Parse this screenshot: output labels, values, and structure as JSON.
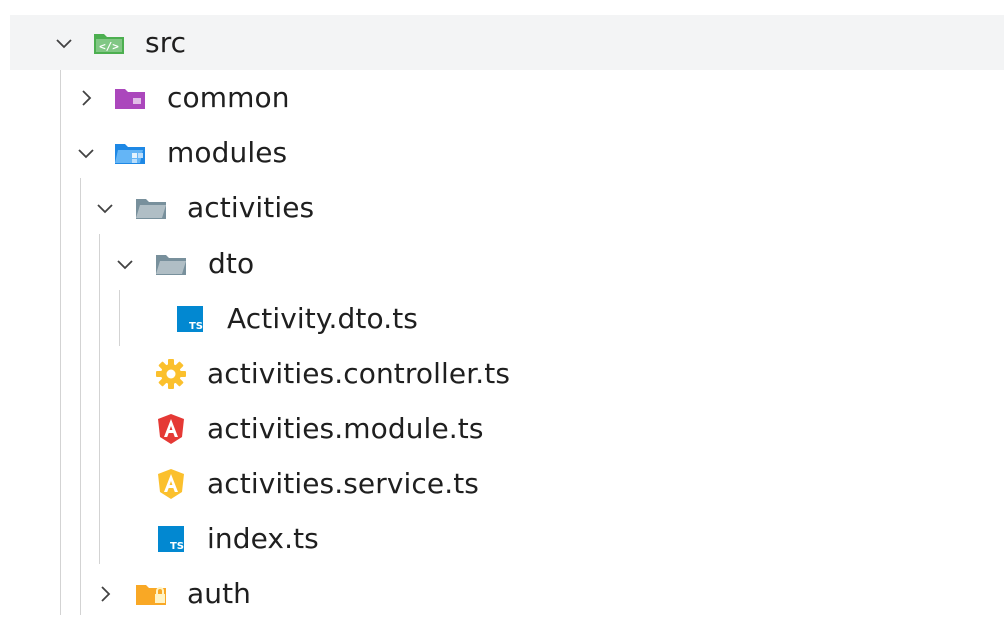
{
  "tree": {
    "items": [
      {
        "label": "src",
        "icon": "src-folder-icon",
        "expanded": true
      },
      {
        "label": "common",
        "icon": "common-folder-icon",
        "expanded": false
      },
      {
        "label": "modules",
        "icon": "modules-folder-icon",
        "expanded": true
      },
      {
        "label": "activities",
        "icon": "folder-open-icon",
        "expanded": true
      },
      {
        "label": "dto",
        "icon": "folder-open-icon",
        "expanded": true
      },
      {
        "label": "Activity.dto.ts",
        "icon": "typescript-file-icon"
      },
      {
        "label": "activities.controller.ts",
        "icon": "controller-gear-icon"
      },
      {
        "label": "activities.module.ts",
        "icon": "angular-module-icon"
      },
      {
        "label": "activities.service.ts",
        "icon": "angular-service-icon"
      },
      {
        "label": "index.ts",
        "icon": "typescript-file-icon"
      },
      {
        "label": "auth",
        "icon": "auth-folder-icon",
        "expanded": false
      }
    ]
  },
  "colors": {
    "src_folder": "#4caf50",
    "common_folder": "#ab47bc",
    "modules_folder": "#1e88e5",
    "plain_folder": "#90a4ae",
    "typescript": "#0288d1",
    "gear": "#fbc02d",
    "angular_module": "#e53935",
    "angular_service": "#fbc02d",
    "auth_folder": "#f9a825"
  }
}
